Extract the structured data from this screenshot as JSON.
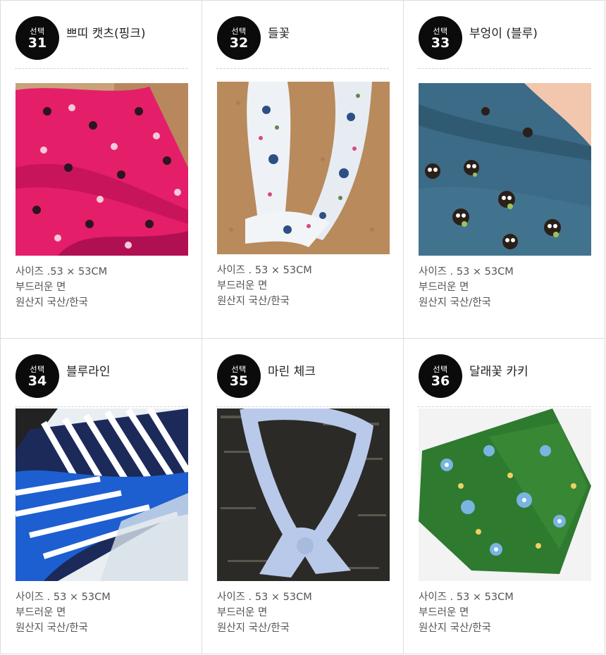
{
  "products": [
    {
      "badge_label": "선택",
      "number": "31",
      "name": "쁘띠 캣츠(핑크)",
      "size": "사이즈 .53 × 53CM",
      "material": "부드러운 면",
      "origin": "원산지 국산/한국"
    },
    {
      "badge_label": "선택",
      "number": "32",
      "name": "들꽃",
      "size": "사이즈 . 53 × 53CM",
      "material": "부드러운 면",
      "origin": "원산지 국산/한국"
    },
    {
      "badge_label": "선택",
      "number": "33",
      "name": "부엉이 (블루)",
      "size": "사이즈 . 53 × 53CM",
      "material": "부드러운 면",
      "origin": "원산지 국산/한국"
    },
    {
      "badge_label": "선택",
      "number": "34",
      "name": "블루라인",
      "size": "사이즈 . 53 × 53CM",
      "material": "부드러운 면",
      "origin": "원산지 국산/한국"
    },
    {
      "badge_label": "선택",
      "number": "35",
      "name": "마린 체크",
      "size": "사이즈 . 53 × 53CM",
      "material": "부드러운 면",
      "origin": "원산지 국산/한국"
    },
    {
      "badge_label": "선택",
      "number": "36",
      "name": "달래꽃 카키",
      "size": "사이즈 . 53 × 53CM",
      "material": "부드러운 면",
      "origin": "원산지 국산/한국"
    }
  ],
  "colors": {
    "badge": "#0b0b0b",
    "border": "#dcdcdc",
    "text": "#555555"
  }
}
